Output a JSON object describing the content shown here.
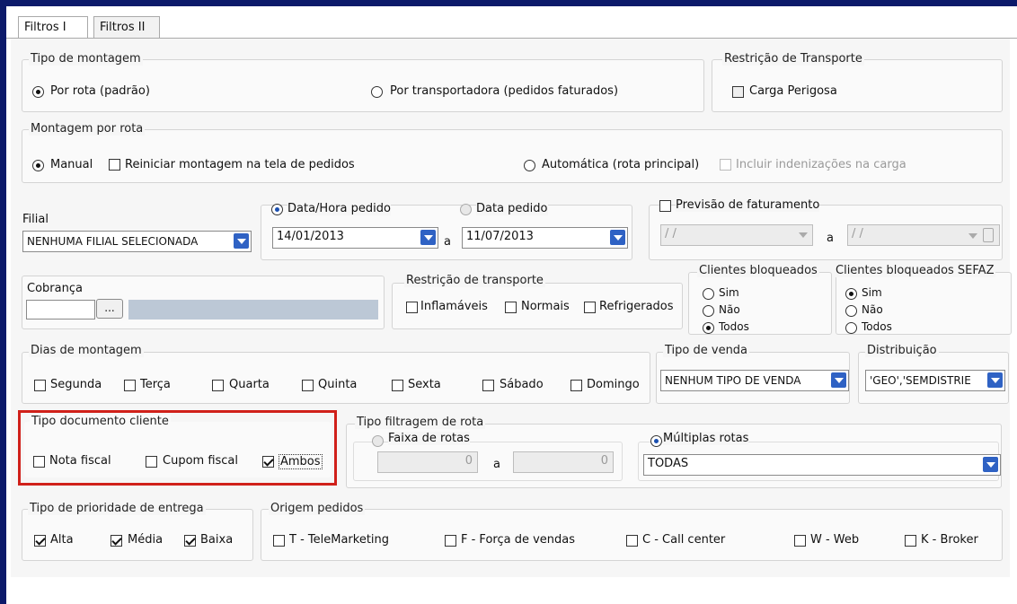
{
  "tabs": [
    "Filtros I",
    "Filtros II"
  ],
  "tipo_montagem": {
    "title": "Tipo de montagem",
    "option1": "Por rota (padrão)",
    "option2": "Por transportadora (pedidos faturados)"
  },
  "restricao_transporte_top": {
    "title": "Restrição de Transporte",
    "checkbox": "Carga Perigosa"
  },
  "montagem_rota": {
    "title": "Montagem por rota",
    "manual": "Manual",
    "reiniciar": "Reiniciar montagem na tela de pedidos",
    "automatica": "Automática (rota principal)",
    "incluir": "Incluir indenizações na carga"
  },
  "filial": {
    "label": "Filial",
    "value": "NENHUMA FILIAL SELECIONADA"
  },
  "data": {
    "opt_datahora": "Data/Hora pedido",
    "opt_data": "Data pedido",
    "from": "14/01/2013",
    "sep": "a",
    "to": "11/07/2013"
  },
  "previsao": {
    "label": "Previsão de faturamento",
    "from": "/ /",
    "sep": "a",
    "to": "/ /"
  },
  "cobranca": {
    "label": "Cobrança",
    "button": "..."
  },
  "restricao_transporte": {
    "title": "Restrição de transporte",
    "items": [
      "Inflamáveis",
      "Normais",
      "Refrigerados"
    ]
  },
  "clientes_bloqueados": {
    "title": "Clientes bloqueados",
    "options": [
      "Sim",
      "Não",
      "Todos"
    ]
  },
  "clientes_bloqueados_sefaz": {
    "title": "Clientes bloqueados SEFAZ",
    "options": [
      "Sim",
      "Não",
      "Todos"
    ]
  },
  "dias_montagem": {
    "title": "Dias de montagem",
    "days": [
      "Segunda",
      "Terça",
      "Quarta",
      "Quinta",
      "Sexta",
      "Sábado",
      "Domingo"
    ]
  },
  "tipo_venda": {
    "title": "Tipo de venda",
    "value": "NENHUM TIPO DE VENDA"
  },
  "distribuicao": {
    "title": "Distribuição",
    "value": "'GEO','SEMDISTRIE"
  },
  "tipo_documento": {
    "title": "Tipo documento cliente",
    "items": [
      "Nota fiscal",
      "Cupom fiscal",
      "Ambos"
    ]
  },
  "tipo_filtragem": {
    "title": "Tipo filtragem de rota",
    "faixa": "Faixa de rotas",
    "from": "0",
    "sep": "a",
    "to": "0",
    "multiplas": "Múltiplas rotas",
    "rotas_value": "TODAS"
  },
  "prioridade": {
    "title": "Tipo de prioridade  de  entrega",
    "items": [
      "Alta",
      "Média",
      "Baixa"
    ]
  },
  "origem": {
    "title": "Origem pedidos",
    "items": [
      "T - TeleMarketing",
      "F - Força de vendas",
      "C - Call center",
      "W - Web",
      "K - Broker"
    ]
  }
}
